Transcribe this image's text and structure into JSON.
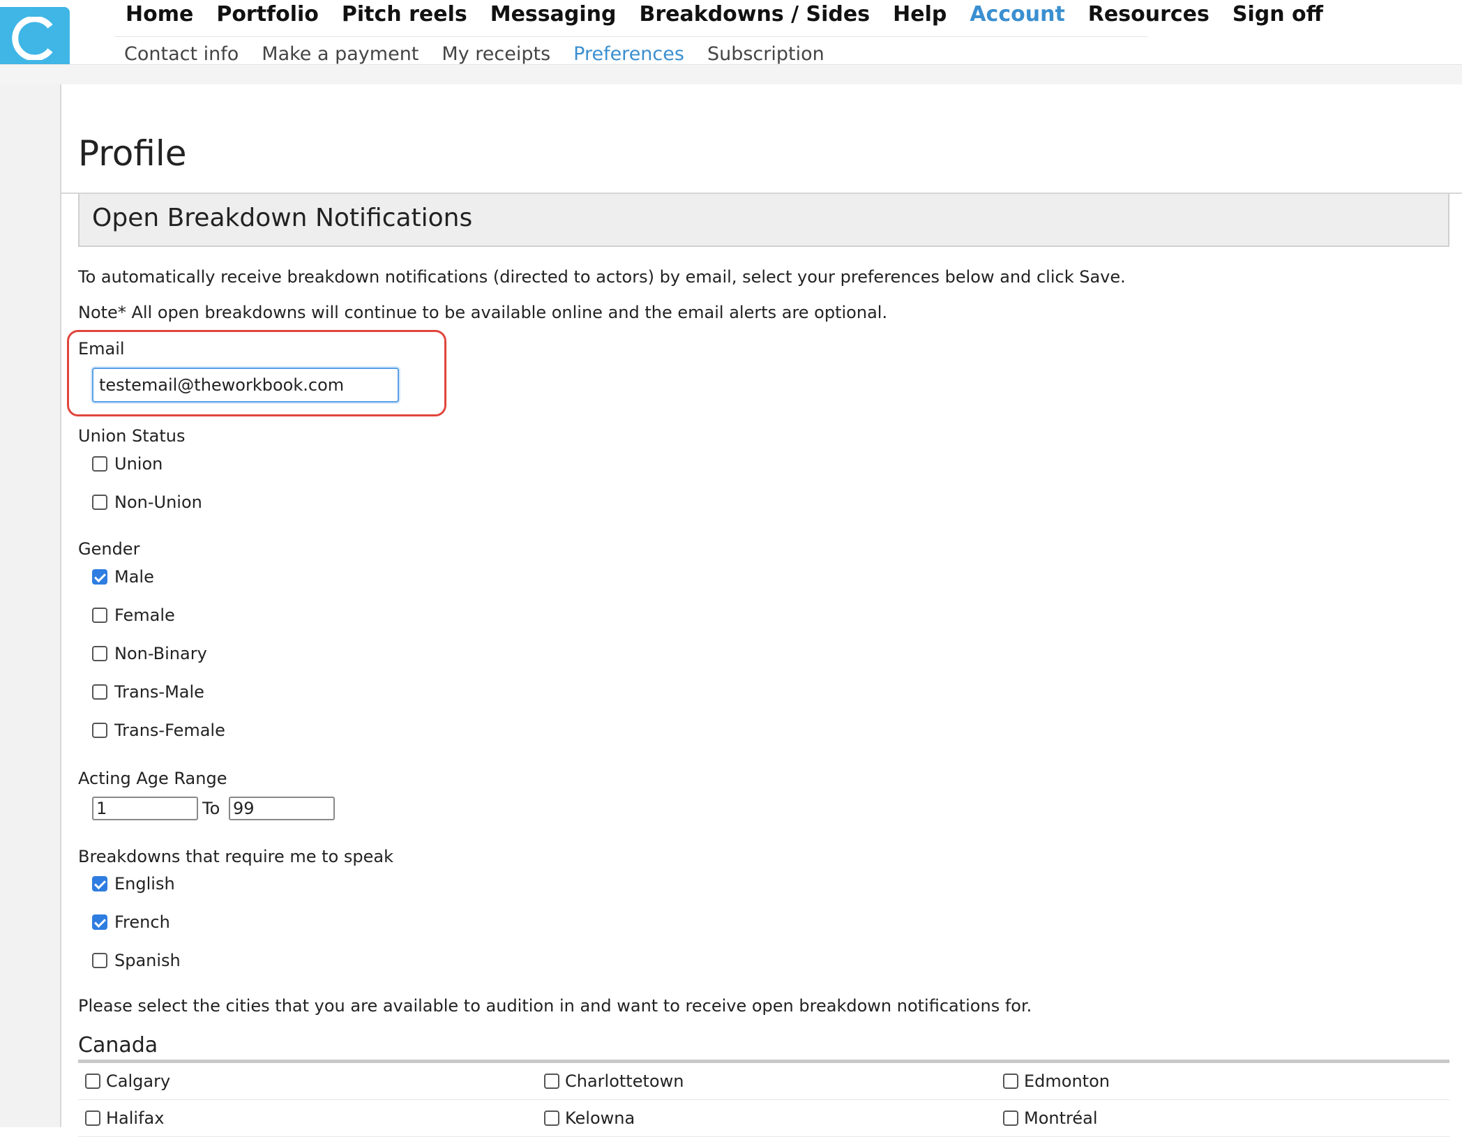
{
  "header": {
    "logo_letter": "C",
    "brand_color": "#3fb6e6",
    "accent_color": "#3a8fd0",
    "nav": [
      {
        "label": "Home",
        "active": false
      },
      {
        "label": "Portfolio",
        "active": false
      },
      {
        "label": "Pitch reels",
        "active": false
      },
      {
        "label": "Messaging",
        "active": false
      },
      {
        "label": "Breakdowns / Sides",
        "active": false
      },
      {
        "label": "Help",
        "active": false
      },
      {
        "label": "Account",
        "active": true
      },
      {
        "label": "Resources",
        "active": false
      },
      {
        "label": "Sign off",
        "active": false
      }
    ],
    "subnav": [
      {
        "label": "Contact info",
        "active": false
      },
      {
        "label": "Make a payment",
        "active": false
      },
      {
        "label": "My receipts",
        "active": false
      },
      {
        "label": "Preferences",
        "active": true
      },
      {
        "label": "Subscription",
        "active": false
      }
    ]
  },
  "page": {
    "title": "Profile",
    "section_title": "Open Breakdown Notifications",
    "intro": "To automatically receive breakdown notifications (directed to actors) by email, select your preferences below and click Save.",
    "note": "Note* All open breakdowns will continue to be available online and the email alerts are optional."
  },
  "email": {
    "label": "Email",
    "value": "testemail@theworkbook.com",
    "highlight_color": "#e0463c"
  },
  "union_status": {
    "label": "Union Status",
    "options": [
      {
        "label": "Union",
        "checked": false
      },
      {
        "label": "Non-Union",
        "checked": false
      }
    ]
  },
  "gender": {
    "label": "Gender",
    "options": [
      {
        "label": "Male",
        "checked": true
      },
      {
        "label": "Female",
        "checked": false
      },
      {
        "label": "Non-Binary",
        "checked": false
      },
      {
        "label": "Trans-Male",
        "checked": false
      },
      {
        "label": "Trans-Female",
        "checked": false
      }
    ]
  },
  "age_range": {
    "label": "Acting Age Range",
    "from": "1",
    "to_label": "To",
    "to": "99"
  },
  "languages": {
    "label": "Breakdowns that require me to speak",
    "options": [
      {
        "label": "English",
        "checked": true
      },
      {
        "label": "French",
        "checked": true
      },
      {
        "label": "Spanish",
        "checked": false
      }
    ]
  },
  "cities": {
    "instruction": "Please select the cities that you are available to audition in and want to receive open breakdown notifications for.",
    "country": "Canada",
    "rows": [
      [
        "Calgary",
        "Charlottetown",
        "Edmonton"
      ],
      [
        "Halifax",
        "Kelowna",
        "Montréal"
      ]
    ]
  }
}
